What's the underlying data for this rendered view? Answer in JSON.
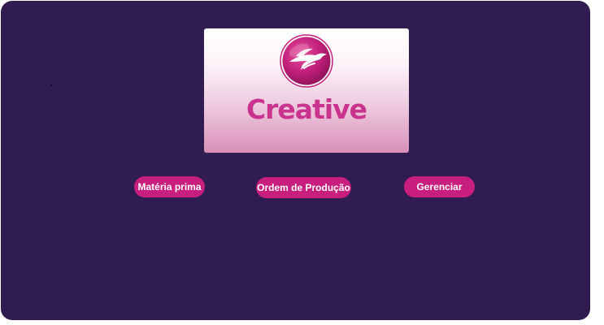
{
  "logo": {
    "wordmark": "Creative",
    "emblem_icon": "bird-emblem-icon"
  },
  "buttons": {
    "materia_prima": "Matéria prima",
    "ordem_producao": "Ordem de Produção",
    "gerenciar": "Gerenciar"
  },
  "colors": {
    "background": "#311c51",
    "button": "#c81f7e",
    "button_text": "#ffffff",
    "logo_text": "#c9338e"
  }
}
